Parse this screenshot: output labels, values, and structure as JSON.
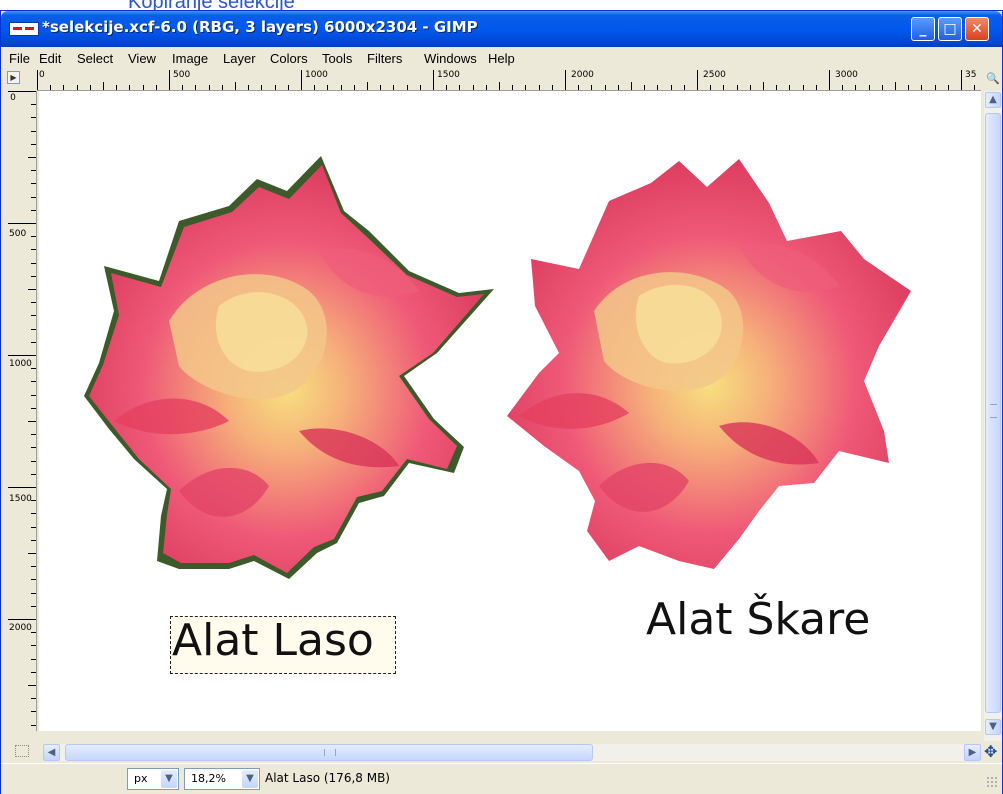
{
  "window": {
    "title": "*selekcije.xcf-6.0 (RBG, 3 layers) 6000x2304 - GIMP",
    "buttons": {
      "minimize": "_",
      "maximize": "□",
      "close": "✕"
    }
  },
  "menu": {
    "items": [
      {
        "label": "File"
      },
      {
        "label": "Edit"
      },
      {
        "label": "Select"
      },
      {
        "label": "View"
      },
      {
        "label": "Image"
      },
      {
        "label": "Layer"
      },
      {
        "label": "Colors"
      },
      {
        "label": "Tools"
      },
      {
        "label": "Filters"
      },
      {
        "label": "Windows"
      },
      {
        "label": "Help"
      }
    ]
  },
  "ruler": {
    "h_labels": [
      "0",
      "500",
      "1000",
      "1500",
      "2000",
      "2500",
      "3000",
      "35"
    ],
    "v_labels": [
      "0",
      "500",
      "1000",
      "1500",
      "2000"
    ]
  },
  "canvas": {
    "caption_left": "Alat Laso",
    "caption_right": "Alat Škare"
  },
  "status": {
    "unit": "px",
    "zoom": "18,2%",
    "info": "Alat Laso (176,8 MB)"
  },
  "colors": {
    "title_bar": "#0058ee",
    "window_bg": "#ece9d8",
    "canvas_bg": "#ffffff",
    "petal": "#e8436a",
    "petal_center": "#f6d28a",
    "lasso_edge": "#3d5a2a"
  }
}
